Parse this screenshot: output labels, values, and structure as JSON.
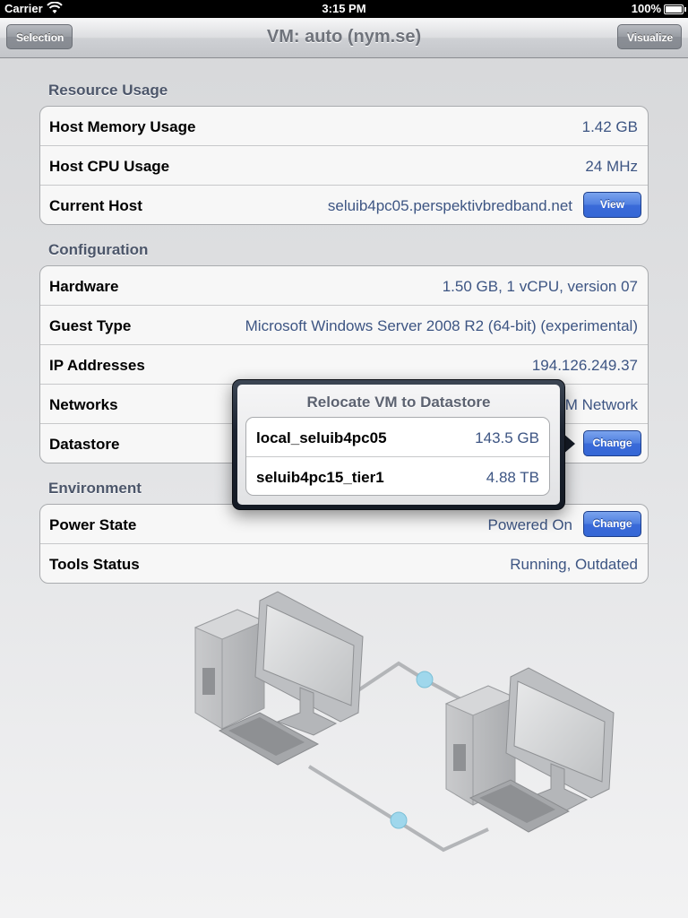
{
  "status_bar": {
    "carrier": "Carrier",
    "time": "3:15 PM",
    "battery": "100%",
    "wifi_icon": "wifi-icon",
    "battery_icon": "battery-icon"
  },
  "nav": {
    "title": "VM: auto (nym.se)",
    "left_button": "Selection",
    "right_button": "Visualize"
  },
  "resource_usage": {
    "title": "Resource Usage",
    "rows": [
      {
        "label": "Host Memory Usage",
        "value": "1.42 GB"
      },
      {
        "label": "Host CPU Usage",
        "value": "24 MHz"
      },
      {
        "label": "Current Host",
        "value": "seluib4pc05.perspektivbredband.net",
        "button": "View"
      }
    ]
  },
  "configuration": {
    "title": "Configuration",
    "rows": [
      {
        "label": "Hardware",
        "value": "1.50 GB, 1 vCPU, version 07"
      },
      {
        "label": "Guest Type",
        "value": "Microsoft Windows Server 2008 R2 (64-bit) (experimental)"
      },
      {
        "label": "IP Addresses",
        "value": "194.126.249.37"
      },
      {
        "label": "Networks",
        "value": "VM Network"
      },
      {
        "label": "Datastore",
        "value": "",
        "button": "Change"
      }
    ]
  },
  "environment": {
    "title": "Environment",
    "rows": [
      {
        "label": "Power State",
        "value": "Powered On",
        "button": "Change"
      },
      {
        "label": "Tools Status",
        "value": "Running, Outdated"
      }
    ]
  },
  "popover": {
    "title": "Relocate VM to Datastore",
    "items": [
      {
        "name": "local_seluib4pc05",
        "size": "143.5 GB"
      },
      {
        "name": "seluib4pc15_tier1",
        "size": "4.88 TB"
      }
    ]
  },
  "colors": {
    "accent_blue": "#3a6ad8",
    "value_text": "#3d5583",
    "section_title": "#4c566a",
    "popover_frame": "#1c2330"
  }
}
